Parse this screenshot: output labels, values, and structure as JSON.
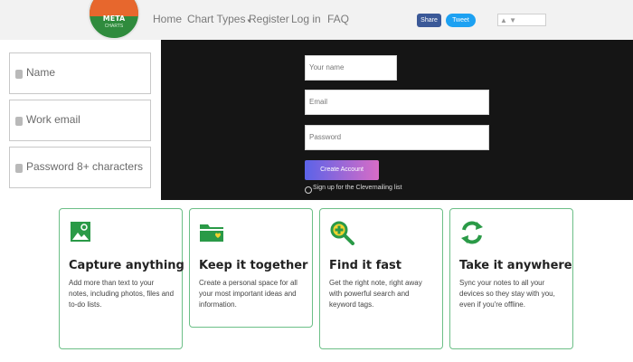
{
  "brand": {
    "logo_text": "META",
    "logo_subtext": "CHARTS"
  },
  "nav": {
    "items": [
      "Home",
      "Chart Types",
      "Register",
      "Log in",
      "FAQ"
    ],
    "caret": "▾"
  },
  "social": {
    "share": "Share",
    "tweet": "Tweet"
  },
  "left_form": {
    "name_placeholder": "Name",
    "email_placeholder": "Work email",
    "password_placeholder": "Password 8+ characters"
  },
  "dark_form": {
    "name_placeholder": "Your name",
    "email_placeholder": "Email",
    "password_placeholder": "Password",
    "submit_label": "Create Account",
    "signup_checkbox_label": "Sign up for the Clevernailing list"
  },
  "features": [
    {
      "icon": "photo-attach-icon",
      "title": "Capture anything",
      "body": "Add more than text to your notes, including photos, files and to-do lists."
    },
    {
      "icon": "folder-heart-icon",
      "title": "Keep it together",
      "body": "Create a personal space for all your most important ideas and information."
    },
    {
      "icon": "magnifier-plus-icon",
      "title": "Find it fast",
      "body": "Get the right note, right away with powerful search and keyword tags."
    },
    {
      "icon": "sync-arrows-icon",
      "title": "Take it anywhere",
      "body": "Sync your notes to all your devices so they stay with you, even if you're offline."
    }
  ],
  "colors": {
    "accent_green": "#2a9a47",
    "card_border": "#6cbf87",
    "cta_gradient_start": "#5b63e8",
    "cta_gradient_end": "#d86cc6",
    "dark_panel": "#151515"
  }
}
